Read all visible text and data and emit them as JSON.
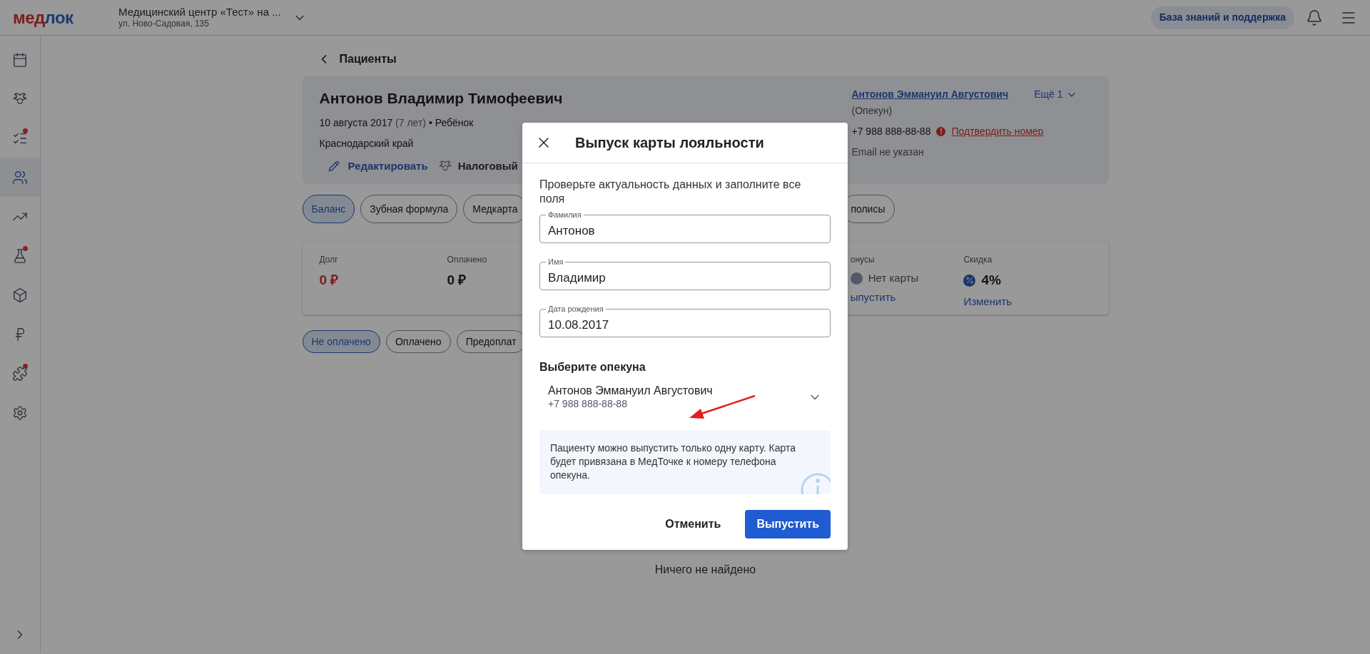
{
  "topbar": {
    "logo": [
      {
        "text": "мед"
      },
      {
        "text": "лок"
      }
    ],
    "clinic": "Медицинский центр «Тест» на ...",
    "address": "ул. Ново-Садовая, 135",
    "help": "База знаний и поддержка"
  },
  "sidebar": {
    "items": [
      {
        "selected": false,
        "dot": false
      },
      {
        "selected": false,
        "dot": false
      },
      {
        "selected": false,
        "dot": true
      },
      {
        "selected": true,
        "dot": false
      },
      {
        "selected": false,
        "dot": false
      },
      {
        "selected": false,
        "dot": true
      },
      {
        "selected": false,
        "dot": false
      },
      {
        "selected": false,
        "dot": false
      },
      {
        "selected": false,
        "dot": true
      },
      {
        "selected": false,
        "dot": false
      }
    ]
  },
  "breadcrumb": "Пациенты",
  "patient": {
    "name": "Антонов Владимир Тимофеевич",
    "birth": "10 августа 2017",
    "age": "(7 лет)",
    "status": "• Ребёнок",
    "region": "Краснодарский край",
    "actions": [
      {
        "kind": "edit",
        "label": "Редактировать"
      },
      {
        "kind": "tax",
        "label": "Налоговый"
      }
    ],
    "guardian": {
      "name": "Антонов Эммануил Августович",
      "role": "(Опекун)",
      "phone": "+7 988 888-88-88",
      "alert": "!",
      "confirm": "Подтвердить номер",
      "email": "Email не указан"
    },
    "more": "Ещё 1"
  },
  "tabs": [
    {
      "label": "Баланс",
      "selected": true
    },
    {
      "label": "Зубная формула",
      "selected": false
    },
    {
      "label": "Медкарта",
      "selected": false
    },
    {
      "label": "полисы",
      "selected": false
    }
  ],
  "balance": [
    {
      "kind": "amount",
      "label": "Долг",
      "value": "0 ₽",
      "danger": true
    },
    {
      "kind": "amount",
      "label": "Оплачено",
      "value": "0 ₽",
      "danger": false
    },
    {
      "kind": "bonus",
      "label": "онусы",
      "value": "Нет карты",
      "link": "ыпустить"
    },
    {
      "kind": "discount",
      "label": "Скидка",
      "value": "4%",
      "link": "Изменить"
    }
  ],
  "filters": [
    {
      "label": "Не оплачено",
      "selected": true
    },
    {
      "label": "Оплачено",
      "selected": false
    },
    {
      "label": "Предоплат",
      "selected": false
    }
  ],
  "empty": "Ничего не найдено",
  "modal": {
    "title": "Выпуск карты лояльности",
    "intro": "Проверьте актуальность данных и заполните все поля",
    "fields": [
      {
        "label": "Фамилия",
        "value": "Антонов"
      },
      {
        "label": "Имя",
        "value": "Владимир"
      },
      {
        "label": "Дата рождения",
        "value": "10.08.2017"
      }
    ],
    "guardian_title": "Выберите опекуна",
    "guardian": {
      "name": "Антонов Эммануил Августович",
      "phone": "+7 988 888-88-88"
    },
    "info": "Пациенту можно выпустить только одну карту. Карта будет привязана в МедТочке к номеру телефона опекуна.",
    "cancel": "Отменить",
    "submit": "Выпустить"
  }
}
